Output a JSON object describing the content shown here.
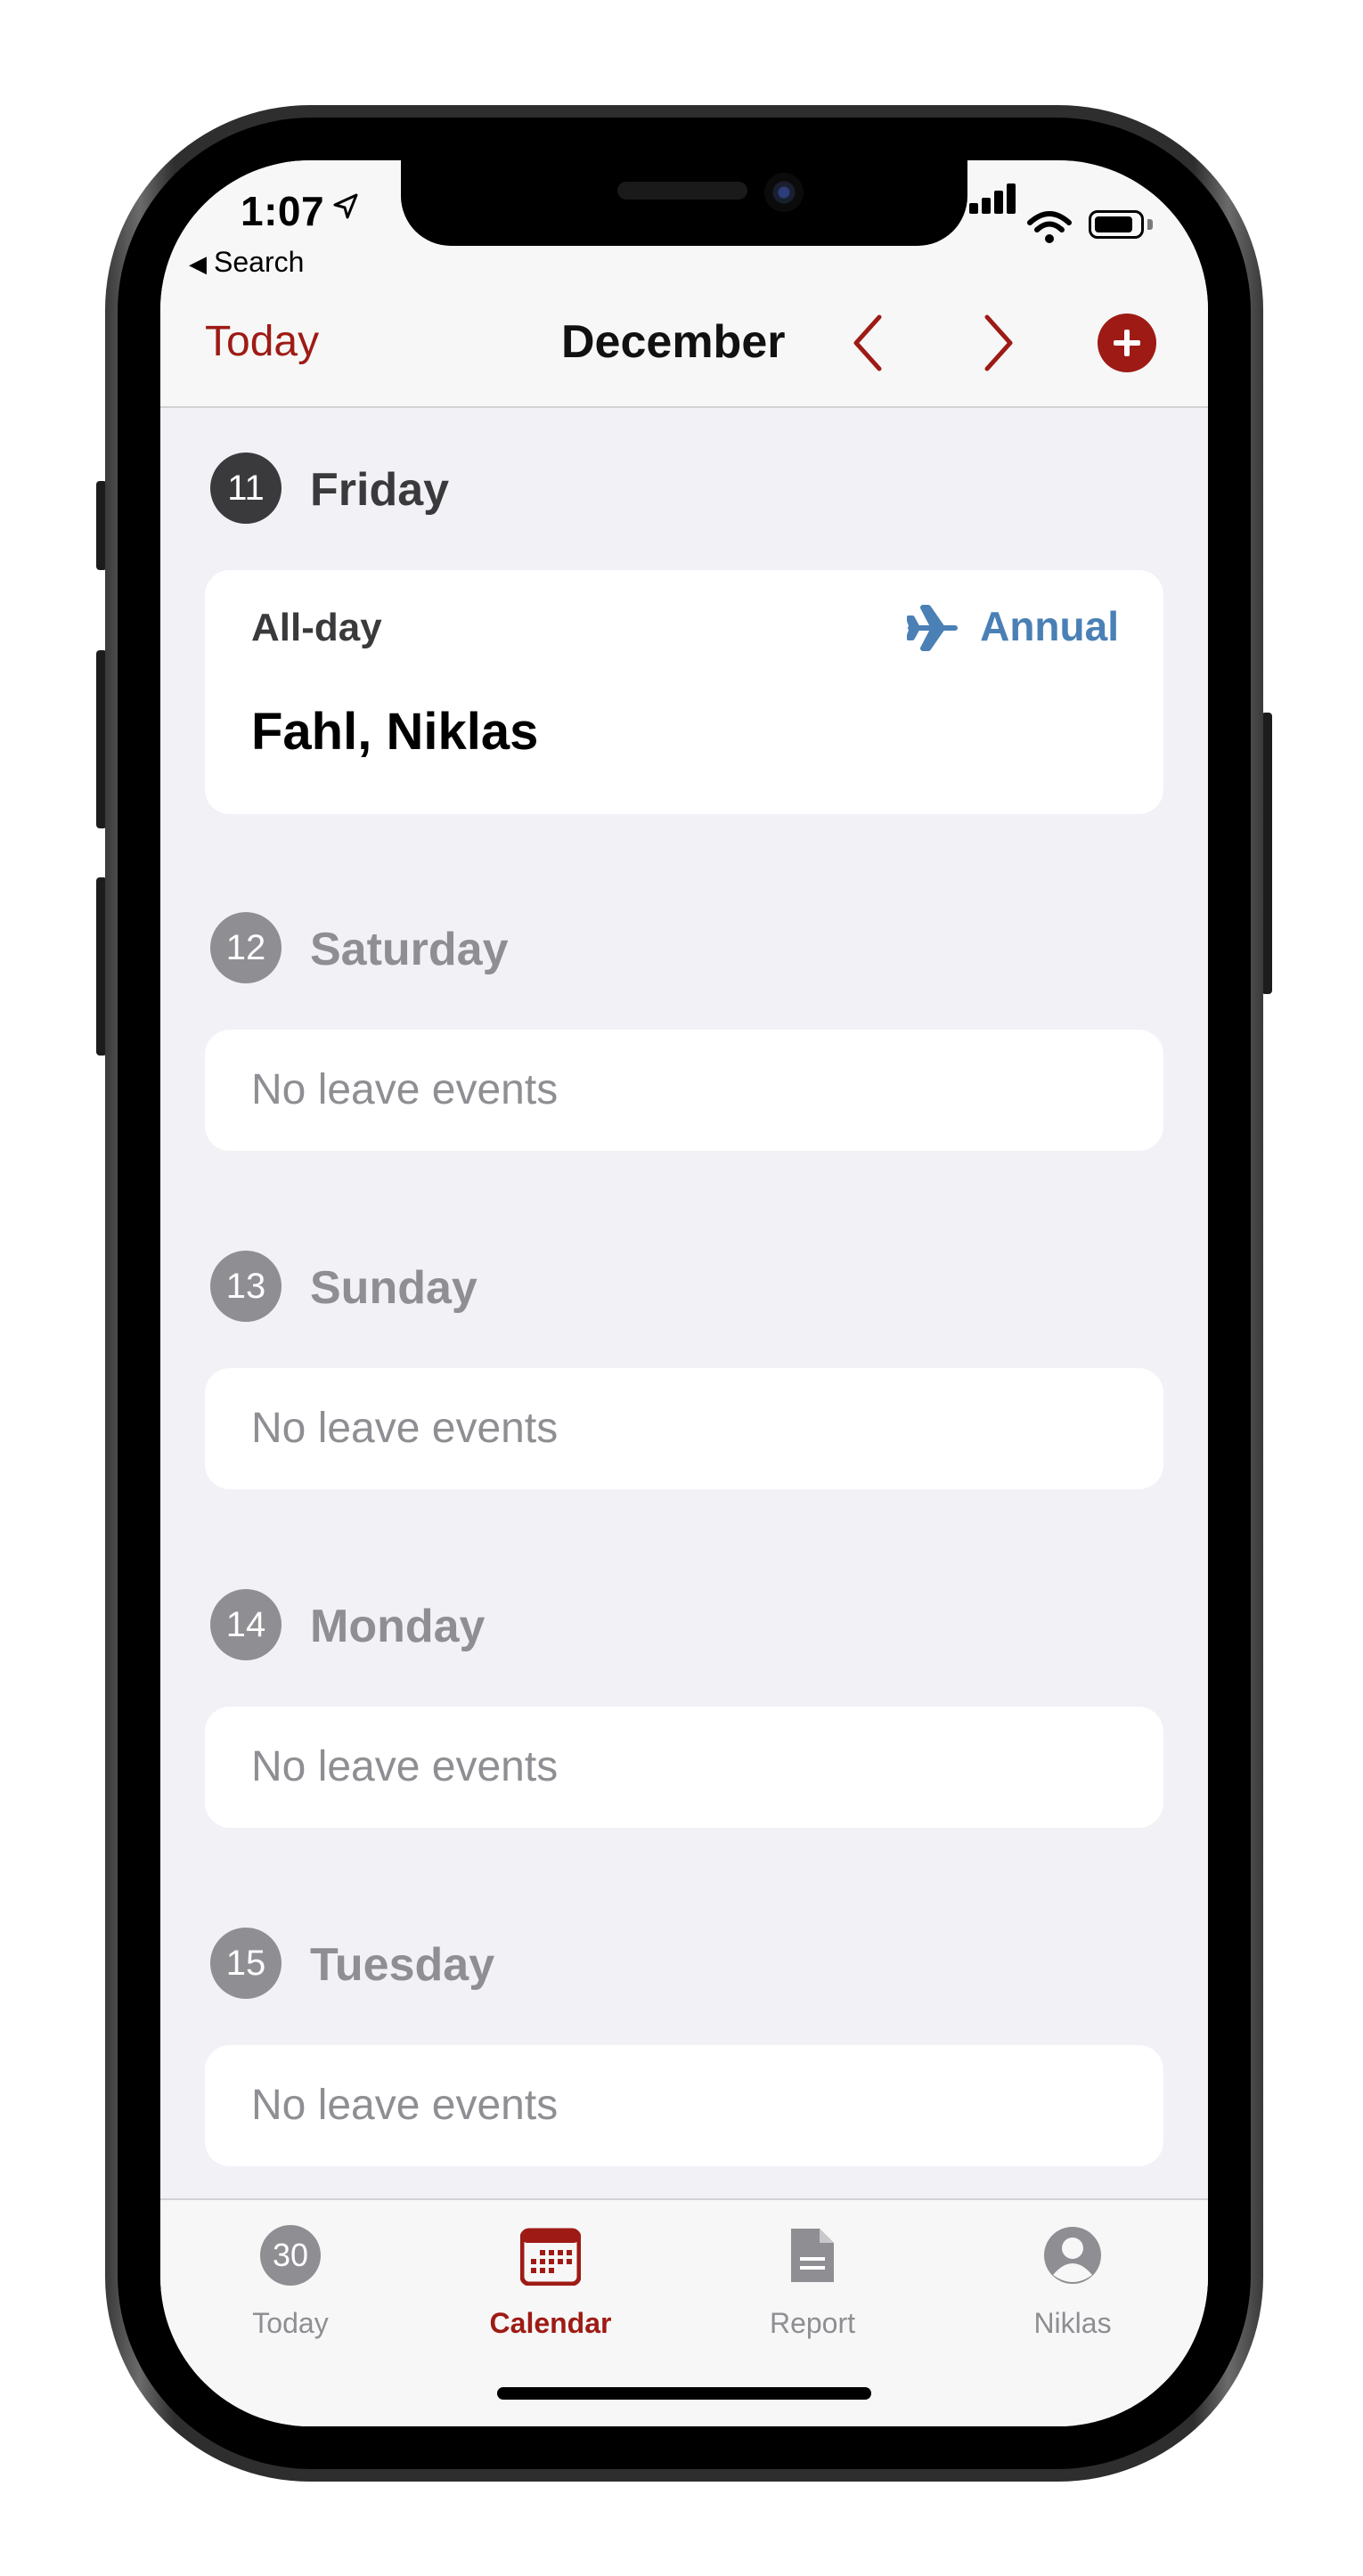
{
  "status_bar": {
    "time": "1:07",
    "back_label": "Search"
  },
  "nav": {
    "today_label": "Today",
    "month_title": "December"
  },
  "days": [
    {
      "number": "11",
      "name": "Friday",
      "current": true,
      "event": {
        "time_label": "All-day",
        "type_label": "Annual",
        "person": "Fahl, Niklas"
      }
    },
    {
      "number": "12",
      "name": "Saturday",
      "empty_text": "No leave events"
    },
    {
      "number": "13",
      "name": "Sunday",
      "empty_text": "No leave events"
    },
    {
      "number": "14",
      "name": "Monday",
      "empty_text": "No leave events"
    },
    {
      "number": "15",
      "name": "Tuesday",
      "empty_text": "No leave events"
    }
  ],
  "tabs": [
    {
      "label": "Today",
      "badge": "30"
    },
    {
      "label": "Calendar",
      "active": true
    },
    {
      "label": "Report"
    },
    {
      "label": "Niklas"
    }
  ],
  "colors": {
    "accent": "#9e1b15",
    "leave_type": "#4a80b5",
    "background": "#f2f1f6"
  },
  "icons": [
    "location-arrow-icon",
    "signal-icon",
    "wifi-icon",
    "battery-icon",
    "chevron-left-icon",
    "chevron-right-icon",
    "plus-icon",
    "airplane-icon",
    "calendar-icon",
    "document-icon",
    "person-icon"
  ]
}
